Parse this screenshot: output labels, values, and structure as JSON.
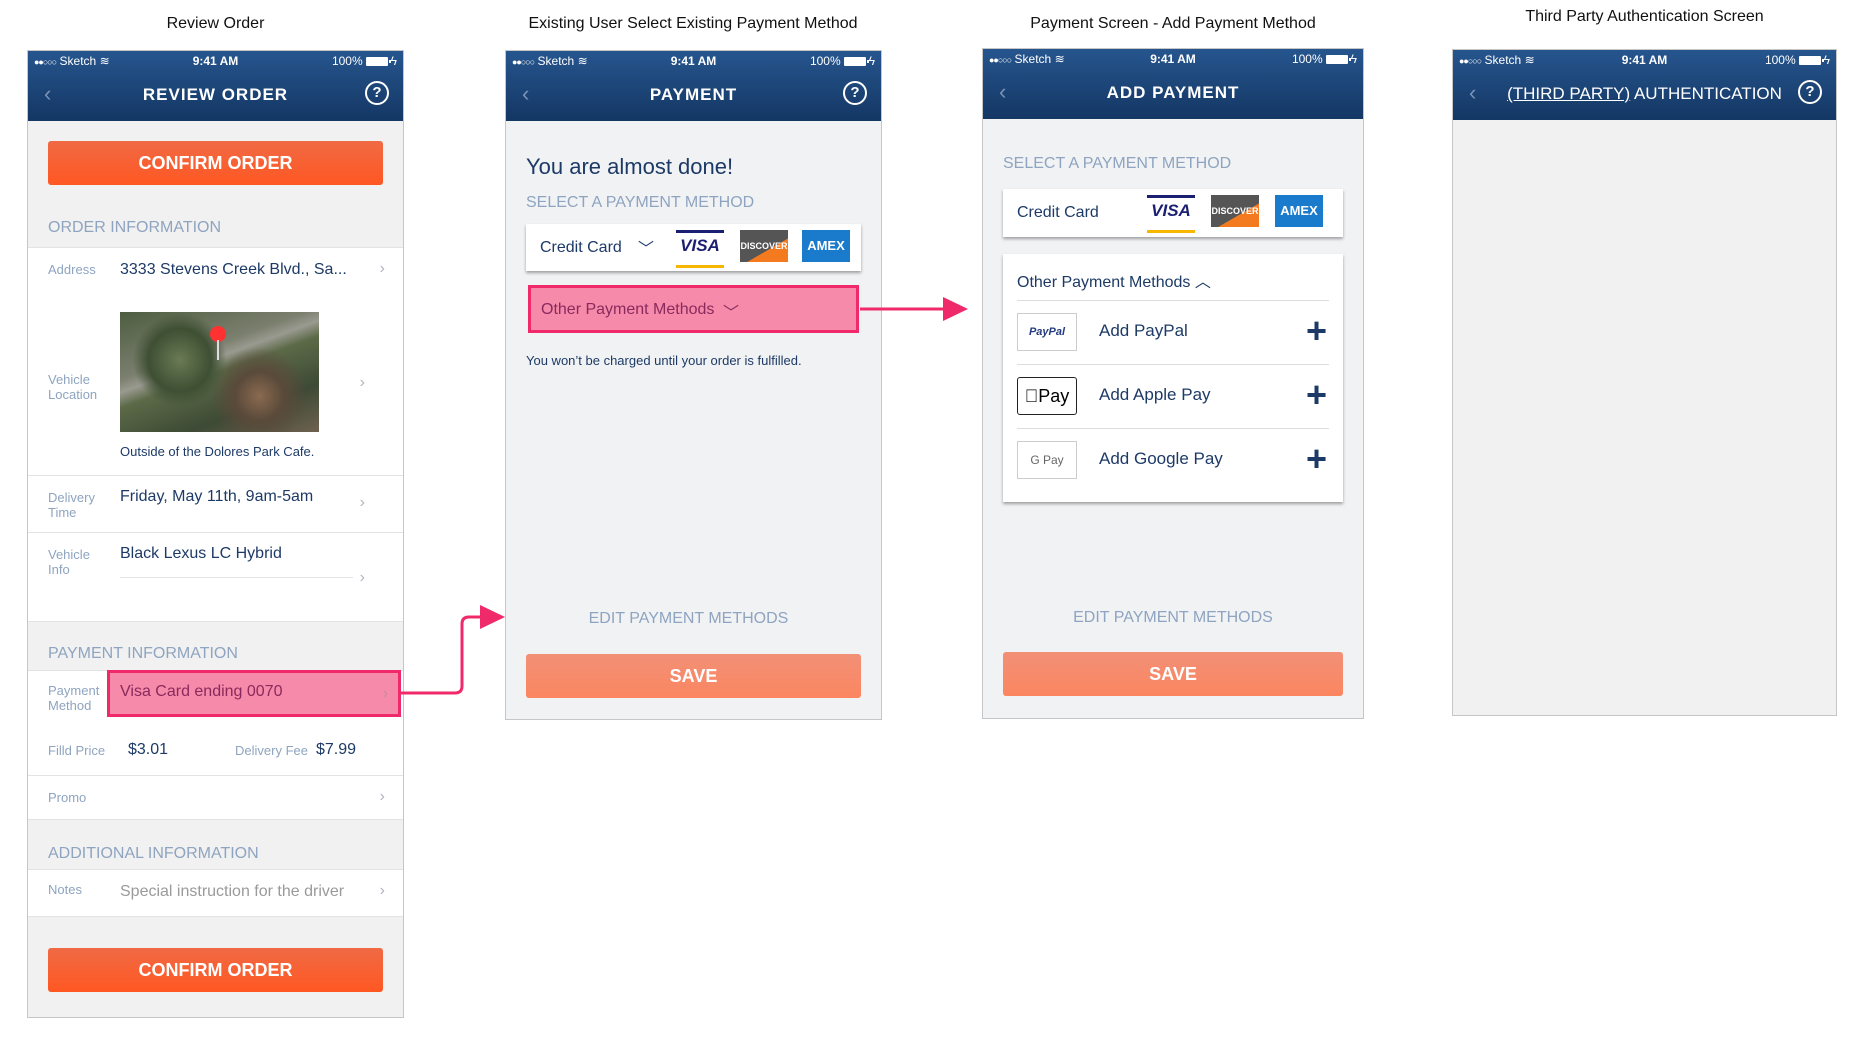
{
  "screens": [
    {
      "title": "Review Order"
    },
    {
      "title": "Existing User Select Existing Payment Method"
    },
    {
      "title": "Payment Screen - Add Payment Method"
    },
    {
      "title": "Third Party Authentication Screen"
    }
  ],
  "status_bar": {
    "carrier": "Sketch",
    "signal": "●●○○○",
    "time": "9:41 AM",
    "battery": "100%"
  },
  "review": {
    "nav_title": "REVIEW ORDER",
    "confirm_label": "CONFIRM ORDER",
    "order_info_header": "ORDER INFORMATION",
    "address_label": "Address",
    "address_value": "3333 Stevens Creek Blvd., Sa...",
    "vehicle_location_label": "Vehicle Location",
    "map_caption": "Outside of the Dolores Park Cafe.",
    "delivery_time_label": "Delivery Time",
    "delivery_time_value": "Friday, May 11th, 9am-5am",
    "vehicle_info_label": "Vehicle Info",
    "vehicle_info_value": "Black Lexus LC Hybrid",
    "payment_info_header": "PAYMENT INFORMATION",
    "payment_method_label": "Payment Method",
    "payment_method_value": "Visa Card ending 0070",
    "fill_price_label": "Filld Price",
    "fill_price_value": "$3.01",
    "delivery_fee_label": "Delivery Fee",
    "delivery_fee_value": "$7.99",
    "promo_label": "Promo",
    "additional_info_header": "ADDITIONAL INFORMATION",
    "notes_label": "Notes",
    "notes_placeholder": "Special instruction for the driver"
  },
  "payment": {
    "nav_title": "PAYMENT",
    "heading": "You are almost done!",
    "select_header": "SELECT A PAYMENT METHOD",
    "credit_card_label": "Credit Card",
    "card_logos": [
      "VISA",
      "DISCOVER",
      "AMEX"
    ],
    "other_methods_label": "Other Payment Methods",
    "disclaimer": "You won’t be charged until your order is fulfilled.",
    "edit_label": "EDIT PAYMENT METHODS",
    "save_label": "SAVE"
  },
  "add_payment": {
    "nav_title": "ADD PAYMENT",
    "select_header": "SELECT A PAYMENT METHOD",
    "credit_card_label": "Credit Card",
    "other_methods_label": "Other Payment Methods",
    "options": [
      {
        "logo": "PayPal",
        "label": "Add PayPal"
      },
      {
        "logo": "Pay",
        "label": "Add Apple Pay"
      },
      {
        "logo": "G Pay",
        "label": "Add Google Pay"
      }
    ],
    "edit_label": "EDIT PAYMENT METHODS",
    "save_label": "SAVE"
  },
  "auth": {
    "nav_title_underlined": "(THIRD PARTY)",
    "nav_title_rest": " AUTHENTICATION"
  },
  "colors": {
    "accent": "#ff5722",
    "header": "#1d3f6e",
    "highlight": "#f0296a"
  }
}
